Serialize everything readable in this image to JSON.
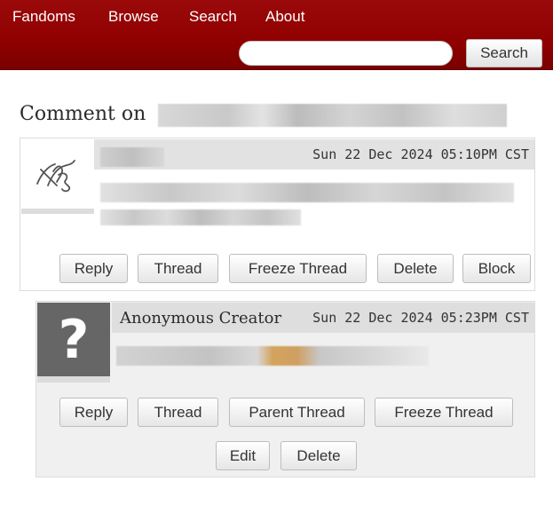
{
  "nav": {
    "items": [
      "Fandoms",
      "Browse",
      "Search",
      "About"
    ],
    "search_placeholder": "",
    "search_button": "Search"
  },
  "heading": {
    "prefix": "Comment on"
  },
  "comments": [
    {
      "author": "",
      "timestamp": "Sun 22 Dec 2024 05:10PM CST",
      "buttons": [
        "Reply",
        "Thread",
        "Freeze Thread",
        "Delete",
        "Block"
      ]
    },
    {
      "author": "Anonymous Creator",
      "avatar_glyph": "?",
      "timestamp": "Sun 22 Dec 2024 05:23PM CST",
      "buttons": [
        "Reply",
        "Thread",
        "Parent Thread",
        "Freeze Thread",
        "Edit",
        "Delete"
      ]
    }
  ],
  "colors": {
    "header": "#900000",
    "anon_avatar": "#666666"
  },
  "icons": {
    "default_avatar": "ao3-default-avatar-icon"
  }
}
